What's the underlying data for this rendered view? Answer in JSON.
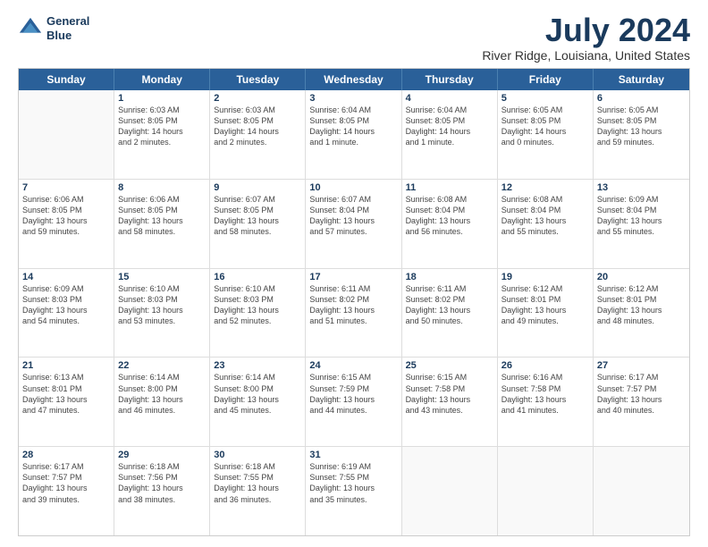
{
  "header": {
    "logo_line1": "General",
    "logo_line2": "Blue",
    "month": "July 2024",
    "location": "River Ridge, Louisiana, United States"
  },
  "days_of_week": [
    "Sunday",
    "Monday",
    "Tuesday",
    "Wednesday",
    "Thursday",
    "Friday",
    "Saturday"
  ],
  "rows": [
    [
      {
        "day": "",
        "empty": true,
        "text": ""
      },
      {
        "day": "1",
        "text": "Sunrise: 6:03 AM\nSunset: 8:05 PM\nDaylight: 14 hours\nand 2 minutes."
      },
      {
        "day": "2",
        "text": "Sunrise: 6:03 AM\nSunset: 8:05 PM\nDaylight: 14 hours\nand 2 minutes."
      },
      {
        "day": "3",
        "text": "Sunrise: 6:04 AM\nSunset: 8:05 PM\nDaylight: 14 hours\nand 1 minute."
      },
      {
        "day": "4",
        "text": "Sunrise: 6:04 AM\nSunset: 8:05 PM\nDaylight: 14 hours\nand 1 minute."
      },
      {
        "day": "5",
        "text": "Sunrise: 6:05 AM\nSunset: 8:05 PM\nDaylight: 14 hours\nand 0 minutes."
      },
      {
        "day": "6",
        "text": "Sunrise: 6:05 AM\nSunset: 8:05 PM\nDaylight: 13 hours\nand 59 minutes."
      }
    ],
    [
      {
        "day": "7",
        "text": "Sunrise: 6:06 AM\nSunset: 8:05 PM\nDaylight: 13 hours\nand 59 minutes."
      },
      {
        "day": "8",
        "text": "Sunrise: 6:06 AM\nSunset: 8:05 PM\nDaylight: 13 hours\nand 58 minutes."
      },
      {
        "day": "9",
        "text": "Sunrise: 6:07 AM\nSunset: 8:05 PM\nDaylight: 13 hours\nand 58 minutes."
      },
      {
        "day": "10",
        "text": "Sunrise: 6:07 AM\nSunset: 8:04 PM\nDaylight: 13 hours\nand 57 minutes."
      },
      {
        "day": "11",
        "text": "Sunrise: 6:08 AM\nSunset: 8:04 PM\nDaylight: 13 hours\nand 56 minutes."
      },
      {
        "day": "12",
        "text": "Sunrise: 6:08 AM\nSunset: 8:04 PM\nDaylight: 13 hours\nand 55 minutes."
      },
      {
        "day": "13",
        "text": "Sunrise: 6:09 AM\nSunset: 8:04 PM\nDaylight: 13 hours\nand 55 minutes."
      }
    ],
    [
      {
        "day": "14",
        "text": "Sunrise: 6:09 AM\nSunset: 8:03 PM\nDaylight: 13 hours\nand 54 minutes."
      },
      {
        "day": "15",
        "text": "Sunrise: 6:10 AM\nSunset: 8:03 PM\nDaylight: 13 hours\nand 53 minutes."
      },
      {
        "day": "16",
        "text": "Sunrise: 6:10 AM\nSunset: 8:03 PM\nDaylight: 13 hours\nand 52 minutes."
      },
      {
        "day": "17",
        "text": "Sunrise: 6:11 AM\nSunset: 8:02 PM\nDaylight: 13 hours\nand 51 minutes."
      },
      {
        "day": "18",
        "text": "Sunrise: 6:11 AM\nSunset: 8:02 PM\nDaylight: 13 hours\nand 50 minutes."
      },
      {
        "day": "19",
        "text": "Sunrise: 6:12 AM\nSunset: 8:01 PM\nDaylight: 13 hours\nand 49 minutes."
      },
      {
        "day": "20",
        "text": "Sunrise: 6:12 AM\nSunset: 8:01 PM\nDaylight: 13 hours\nand 48 minutes."
      }
    ],
    [
      {
        "day": "21",
        "text": "Sunrise: 6:13 AM\nSunset: 8:01 PM\nDaylight: 13 hours\nand 47 minutes."
      },
      {
        "day": "22",
        "text": "Sunrise: 6:14 AM\nSunset: 8:00 PM\nDaylight: 13 hours\nand 46 minutes."
      },
      {
        "day": "23",
        "text": "Sunrise: 6:14 AM\nSunset: 8:00 PM\nDaylight: 13 hours\nand 45 minutes."
      },
      {
        "day": "24",
        "text": "Sunrise: 6:15 AM\nSunset: 7:59 PM\nDaylight: 13 hours\nand 44 minutes."
      },
      {
        "day": "25",
        "text": "Sunrise: 6:15 AM\nSunset: 7:58 PM\nDaylight: 13 hours\nand 43 minutes."
      },
      {
        "day": "26",
        "text": "Sunrise: 6:16 AM\nSunset: 7:58 PM\nDaylight: 13 hours\nand 41 minutes."
      },
      {
        "day": "27",
        "text": "Sunrise: 6:17 AM\nSunset: 7:57 PM\nDaylight: 13 hours\nand 40 minutes."
      }
    ],
    [
      {
        "day": "28",
        "text": "Sunrise: 6:17 AM\nSunset: 7:57 PM\nDaylight: 13 hours\nand 39 minutes."
      },
      {
        "day": "29",
        "text": "Sunrise: 6:18 AM\nSunset: 7:56 PM\nDaylight: 13 hours\nand 38 minutes."
      },
      {
        "day": "30",
        "text": "Sunrise: 6:18 AM\nSunset: 7:55 PM\nDaylight: 13 hours\nand 36 minutes."
      },
      {
        "day": "31",
        "text": "Sunrise: 6:19 AM\nSunset: 7:55 PM\nDaylight: 13 hours\nand 35 minutes."
      },
      {
        "day": "",
        "empty": true,
        "text": ""
      },
      {
        "day": "",
        "empty": true,
        "text": ""
      },
      {
        "day": "",
        "empty": true,
        "text": ""
      }
    ]
  ]
}
